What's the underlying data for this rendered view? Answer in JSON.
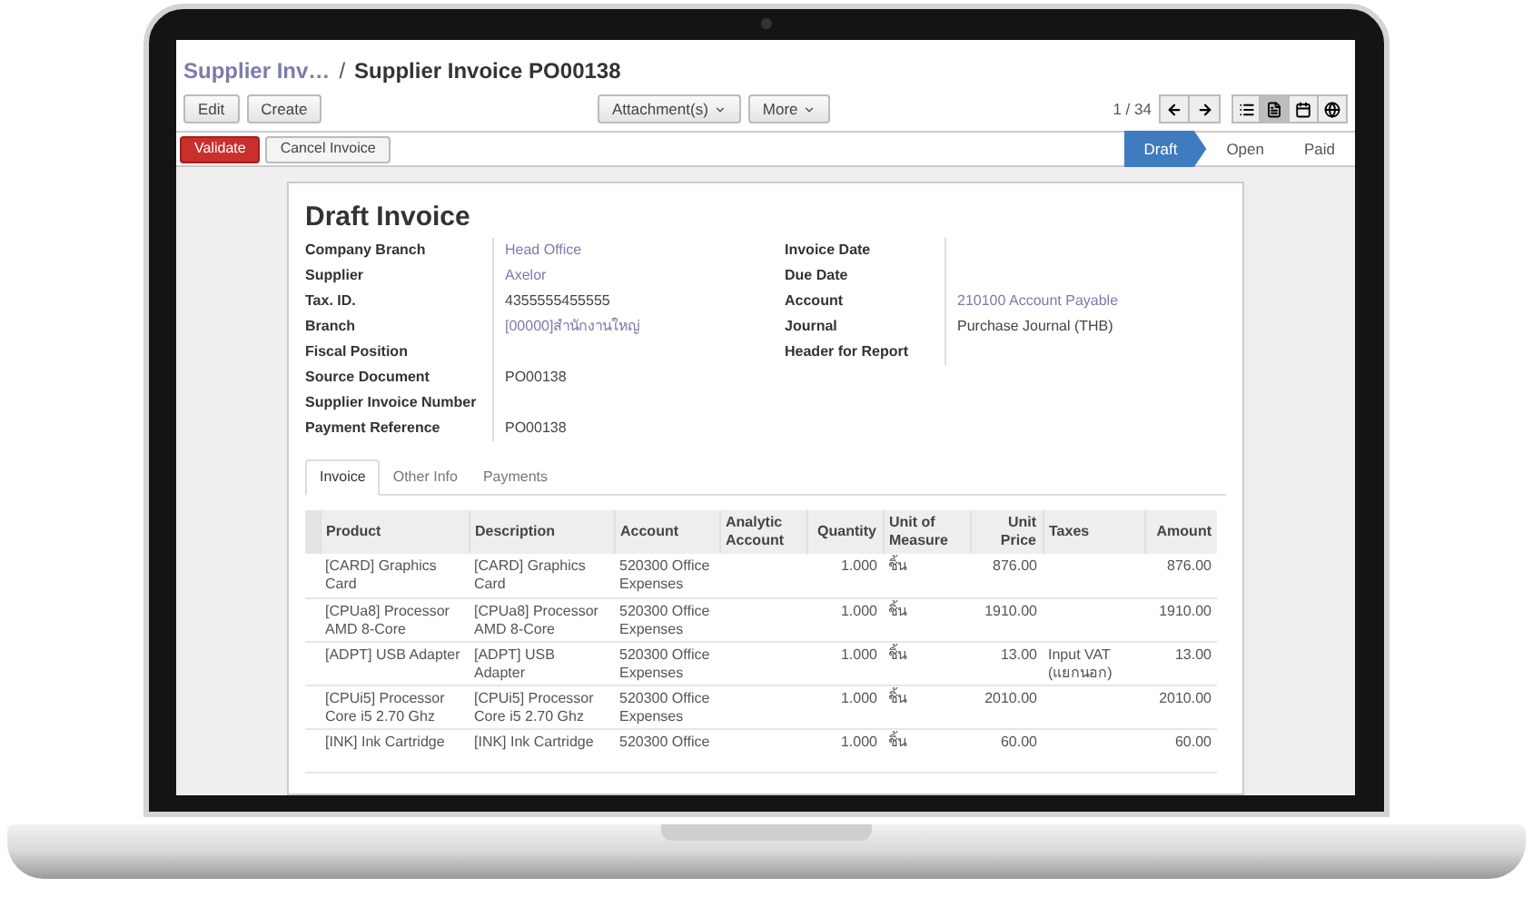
{
  "breadcrumb": {
    "parent": "Supplier Inv…",
    "separator": "/",
    "current": "Supplier Invoice PO00138"
  },
  "toolbar": {
    "left_buttons": [
      "Edit",
      "Create"
    ],
    "dropdowns": [
      "Attachment(s)",
      "More"
    ],
    "pager": "1 / 34",
    "views": [
      {
        "kind": "list",
        "selected": false
      },
      {
        "kind": "form",
        "selected": true
      },
      {
        "kind": "calendar",
        "selected": false
      },
      {
        "kind": "map",
        "selected": false
      }
    ]
  },
  "actions": [
    {
      "label": "Validate",
      "kind": "primary"
    },
    {
      "label": "Cancel Invoice",
      "kind": "default"
    }
  ],
  "stages": [
    {
      "label": "Draft",
      "selected": true
    },
    {
      "label": "Open",
      "selected": false
    },
    {
      "label": "Paid",
      "selected": false
    }
  ],
  "sheet": {
    "title": "Draft Invoice",
    "left_fields": [
      {
        "label": "Company Branch",
        "value": "Head Office",
        "kind": "link"
      },
      {
        "label": "Supplier",
        "value": "Axelor",
        "kind": "link"
      },
      {
        "label": "Tax. ID.",
        "value": "4355555455555",
        "kind": "text"
      },
      {
        "label": "Branch",
        "value": "[00000]สำนักงานใหญ่",
        "kind": "link"
      },
      {
        "label": "Fiscal Position"
      },
      {
        "label": "Source Document",
        "value": "PO00138",
        "kind": "text"
      },
      {
        "label": "Supplier Invoice Number"
      },
      {
        "label": "Payment Reference",
        "value": "PO00138",
        "kind": "text"
      }
    ],
    "right_fields": [
      {
        "label": "Invoice Date"
      },
      {
        "label": "Due Date"
      },
      {
        "label": "Account",
        "value": "210100 Account Payable",
        "kind": "link"
      },
      {
        "label": "Journal",
        "value": "Purchase Journal (THB)",
        "kind": "text"
      },
      {
        "label": "Header for Report"
      }
    ],
    "tabs": [
      {
        "label": "Invoice",
        "selected": true
      },
      {
        "label": "Other Info",
        "selected": false
      },
      {
        "label": "Payments",
        "selected": false
      }
    ],
    "table": {
      "columns": [
        "Product",
        "Description",
        "Account",
        "Analytic Account",
        "Quantity",
        "Unit of Measure",
        "Unit Price",
        "Taxes",
        "Amount"
      ],
      "rows": [
        [
          "[CARD] Graphics Card",
          "[CARD] Graphics Card",
          "520300 Office Expenses",
          "",
          "1.000",
          "ชิ้น",
          "876.00",
          "",
          "876.00"
        ],
        [
          "[CPUa8] Processor AMD 8-Core",
          "[CPUa8] Processor AMD 8-Core",
          "520300 Office Expenses",
          "",
          "1.000",
          "ชิ้น",
          "1910.00",
          "",
          "1910.00"
        ],
        [
          "[ADPT] USB Adapter",
          "[ADPT] USB Adapter",
          "520300 Office Expenses",
          "",
          "1.000",
          "ชิ้น",
          "13.00",
          "Input VAT (แยกนอก)",
          "13.00"
        ],
        [
          "[CPUi5] Processor Core i5 2.70 Ghz",
          "[CPUi5] Processor Core i5 2.70 Ghz",
          "520300 Office Expenses",
          "",
          "1.000",
          "ชิ้น",
          "2010.00",
          "",
          "2010.00"
        ],
        [
          "[INK] Ink Cartridge",
          "[INK] Ink Cartridge",
          "520300 Office",
          "",
          "1.000",
          "ชิ้น",
          "60.00",
          "",
          "60.00"
        ]
      ]
    }
  }
}
